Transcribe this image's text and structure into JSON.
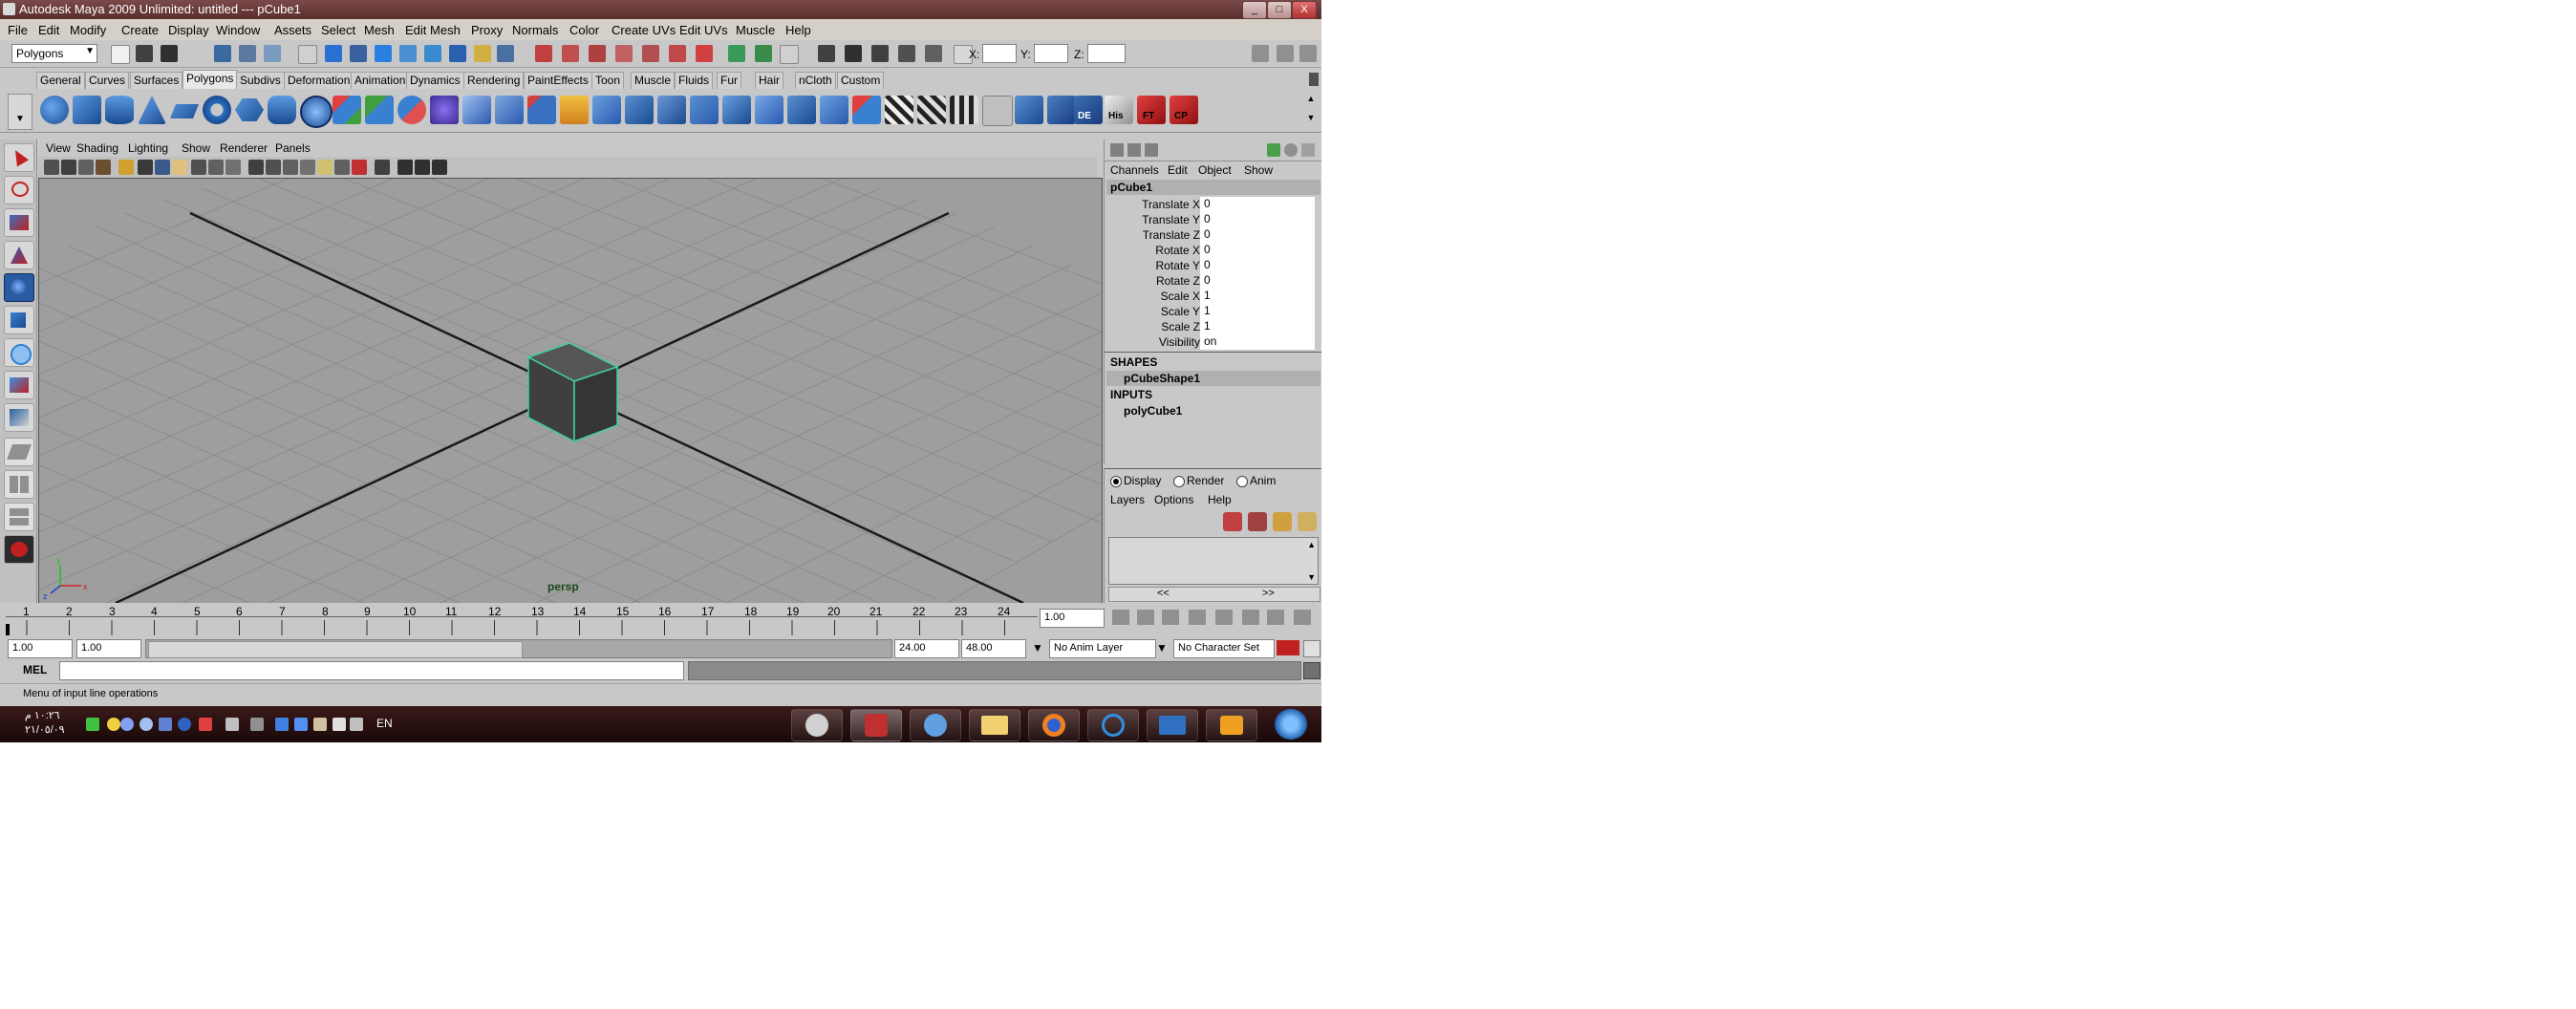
{
  "window": {
    "title": "Autodesk Maya 2009 Unlimited: untitled   ---   pCube1",
    "minimize": "_",
    "maximize": "□",
    "close": "X"
  },
  "menubar": [
    "File",
    "Edit",
    "Modify",
    "Create",
    "Display",
    "Window",
    "Assets",
    "Select",
    "Mesh",
    "Edit Mesh",
    "Proxy",
    "Normals",
    "Color",
    "Create UVs",
    "Edit UVs",
    "Muscle",
    "Help"
  ],
  "statusline": {
    "menuset": "Polygons",
    "x_label": "X:",
    "y_label": "Y:",
    "z_label": "Z:"
  },
  "shelf_tabs": [
    "General",
    "Curves",
    "Surfaces",
    "Polygons",
    "Subdivs",
    "Deformation",
    "Animation",
    "Dynamics",
    "Rendering",
    "PaintEffects",
    "Toon",
    "Muscle",
    "Fluids",
    "Fur",
    "Hair",
    "nCloth",
    "Custom"
  ],
  "active_shelf": "Polygons",
  "shelf_labels": {
    "de": "DE",
    "his": "His",
    "ft": "FT",
    "cp": "CP"
  },
  "viewport": {
    "menus": [
      "View",
      "Shading",
      "Lighting",
      "Show",
      "Renderer",
      "Panels"
    ],
    "camera": "persp",
    "axes": {
      "x": "x",
      "y": "y",
      "z": "z"
    }
  },
  "channelbox": {
    "menus": [
      "Channels",
      "Edit",
      "Object",
      "Show"
    ],
    "object": "pCube1",
    "attributes": [
      {
        "name": "Translate X",
        "value": "0"
      },
      {
        "name": "Translate Y",
        "value": "0"
      },
      {
        "name": "Translate Z",
        "value": "0"
      },
      {
        "name": "Rotate X",
        "value": "0"
      },
      {
        "name": "Rotate Y",
        "value": "0"
      },
      {
        "name": "Rotate Z",
        "value": "0"
      },
      {
        "name": "Scale X",
        "value": "1"
      },
      {
        "name": "Scale Y",
        "value": "1"
      },
      {
        "name": "Scale Z",
        "value": "1"
      },
      {
        "name": "Visibility",
        "value": "on"
      }
    ],
    "shapes_header": "SHAPES",
    "shape": "pCubeShape1",
    "inputs_header": "INPUTS",
    "input": "polyCube1"
  },
  "layer_editor": {
    "modes": [
      "Display",
      "Render",
      "Anim"
    ],
    "selected_mode": "Display",
    "menus": [
      "Layers",
      "Options",
      "Help"
    ],
    "scroll_left": "<<",
    "scroll_right": ">>"
  },
  "timeline": {
    "ticks": [
      "1",
      "2",
      "3",
      "4",
      "5",
      "6",
      "7",
      "8",
      "9",
      "10",
      "11",
      "12",
      "13",
      "14",
      "15",
      "16",
      "17",
      "18",
      "19",
      "20",
      "21",
      "22",
      "23",
      "24"
    ],
    "current_time": "1.00"
  },
  "range": {
    "start": "1.00",
    "playback_start": "1.00",
    "playback_end": "24.00",
    "end": "48.00",
    "anim_layer": "No Anim Layer",
    "character_set": "No Character Set"
  },
  "cmdline": {
    "label": "MEL"
  },
  "helpline": {
    "text": "Menu of input line operations"
  },
  "taskbar": {
    "time": "١٠:٢٦ م",
    "date": "٢١/٠٥/٠٩",
    "language": "EN"
  },
  "colors": {
    "titlebar": "#6b3b3b",
    "viewport_bg": "#9e9e9e",
    "grid": "#8a8a8a",
    "cube_face": "#3f3f3f",
    "cube_edge": "#3fd0a0",
    "shelf_icon_blue": "#2a6fc0",
    "taskbar": "#2a1010"
  }
}
